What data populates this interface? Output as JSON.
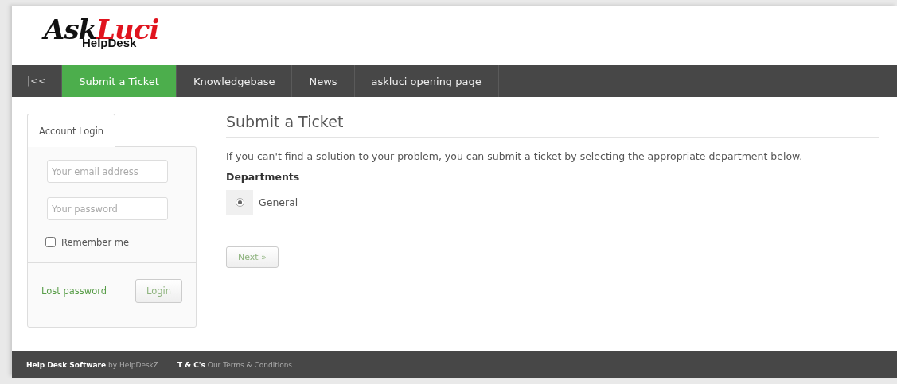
{
  "logo": {
    "script_1": "Ask",
    "script_2": "Luci",
    "subtitle": "HelpDesk"
  },
  "nav": [
    {
      "label": "|<<",
      "kind": "collapse",
      "selected": false
    },
    {
      "label": "Submit a Ticket",
      "kind": "link",
      "selected": true
    },
    {
      "label": "Knowledgebase",
      "kind": "link",
      "selected": false
    },
    {
      "label": "News",
      "kind": "link",
      "selected": false
    },
    {
      "label": "askluci opening page",
      "kind": "link",
      "selected": false
    }
  ],
  "login": {
    "tab": "Account Login",
    "email": {
      "placeholder": "Your email address"
    },
    "password": {
      "placeholder": "Your password"
    },
    "remember": {
      "label": "Remember me",
      "checked": false
    },
    "lost_password": "Lost password",
    "button": "Login"
  },
  "main": {
    "title": "Submit a Ticket",
    "intro": "If you can't find a solution to your problem, you can submit a ticket by selecting the appropriate department below.",
    "departments_label": "Departments",
    "departments": [
      {
        "label": "General",
        "selected": true
      }
    ],
    "button": "Next »"
  },
  "footer": [
    "**Help Desk Software** by HelpDeskZ",
    "**T & C's** Our Terms & Conditions"
  ]
}
